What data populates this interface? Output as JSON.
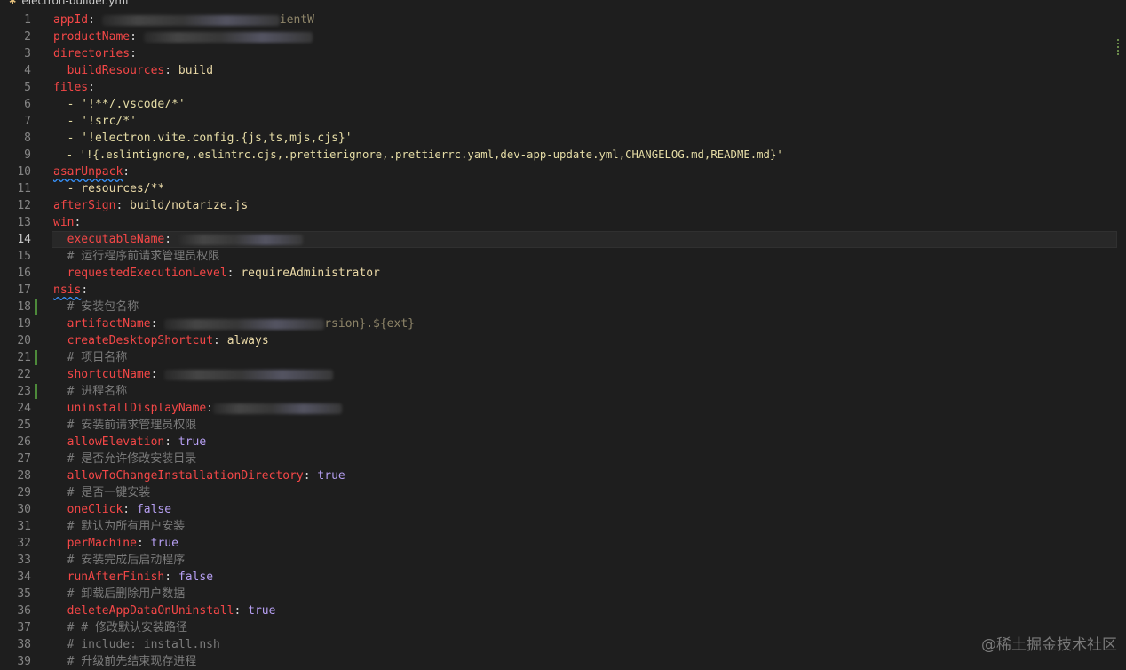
{
  "tab": {
    "filename": "electron-builder.yml",
    "icon": "yaml-file-icon"
  },
  "editor": {
    "lines": {
      "l1": {
        "num": "1",
        "key": "appId",
        "sep": ": "
      },
      "l2": {
        "num": "2",
        "key": "productName",
        "sep": ": "
      },
      "l3": {
        "num": "3",
        "key": "directories",
        "sep": ":"
      },
      "l4": {
        "num": "4",
        "indent": "  ",
        "key": "buildResources",
        "sep": ": ",
        "val": "build"
      },
      "l5": {
        "num": "5",
        "key": "files",
        "sep": ":"
      },
      "l6": {
        "num": "6",
        "val": "  - '!**/.vscode/*'"
      },
      "l7": {
        "num": "7",
        "val": "  - '!src/*'"
      },
      "l8": {
        "num": "8",
        "val": "  - '!electron.vite.config.{js,ts,mjs,cjs}'"
      },
      "l9": {
        "num": "9",
        "val": "  - '!{.eslintignore,.eslintrc.cjs,.prettierignore,.prettierrc.yaml,dev-app-update.yml,CHANGELOG.md,README.md}'"
      },
      "l10": {
        "num": "10",
        "key": "asarUnpack",
        "sep": ":"
      },
      "l11": {
        "num": "11",
        "val": "  - resources/**"
      },
      "l12": {
        "num": "12",
        "key": "afterSign",
        "sep": ": ",
        "val": "build/notarize.js"
      },
      "l13": {
        "num": "13",
        "key": "win",
        "sep": ":"
      },
      "l14": {
        "num": "14",
        "indent": "  ",
        "key": "executableName",
        "sep": ": "
      },
      "l15": {
        "num": "15",
        "comment": "  # 运行程序前请求管理员权限"
      },
      "l16": {
        "num": "16",
        "indent": "  ",
        "key": "requestedExecutionLevel",
        "sep": ": ",
        "val": "requireAdministrator"
      },
      "l17": {
        "num": "17",
        "key": "nsis",
        "sep": ":"
      },
      "l18": {
        "num": "18",
        "comment": "  # 安装包名称"
      },
      "l19": {
        "num": "19",
        "indent": "  ",
        "key": "artifactName",
        "sep": ": "
      },
      "l20": {
        "num": "20",
        "indent": "  ",
        "key": "createDesktopShortcut",
        "sep": ": ",
        "val": "always"
      },
      "l21": {
        "num": "21",
        "comment": "  # 项目名称"
      },
      "l22": {
        "num": "22",
        "indent": "  ",
        "key": "shortcutName",
        "sep": ": "
      },
      "l23": {
        "num": "23",
        "comment": "  # 进程名称"
      },
      "l24": {
        "num": "24",
        "indent": "  ",
        "key": "uninstallDisplayName",
        "sep": ":"
      },
      "l25": {
        "num": "25",
        "comment": "  # 安装前请求管理员权限"
      },
      "l26": {
        "num": "26",
        "indent": "  ",
        "key": "allowElevation",
        "sep": ": ",
        "bool": "true"
      },
      "l27": {
        "num": "27",
        "comment": "  # 是否允许修改安装目录"
      },
      "l28": {
        "num": "28",
        "indent": "  ",
        "key": "allowToChangeInstallationDirectory",
        "sep": ": ",
        "bool": "true"
      },
      "l29": {
        "num": "29",
        "comment": "  # 是否一键安装"
      },
      "l30": {
        "num": "30",
        "indent": "  ",
        "key": "oneClick",
        "sep": ": ",
        "bool": "false"
      },
      "l31": {
        "num": "31",
        "comment": "  # 默认为所有用户安装"
      },
      "l32": {
        "num": "32",
        "indent": "  ",
        "key": "perMachine",
        "sep": ": ",
        "bool": "true"
      },
      "l33": {
        "num": "33",
        "comment": "  # 安装完成后启动程序"
      },
      "l34": {
        "num": "34",
        "indent": "  ",
        "key": "runAfterFinish",
        "sep": ": ",
        "bool": "false"
      },
      "l35": {
        "num": "35",
        "comment": "  # 卸载后删除用户数据"
      },
      "l36": {
        "num": "36",
        "indent": "  ",
        "key": "deleteAppDataOnUninstall",
        "sep": ": ",
        "bool": "true"
      },
      "l37": {
        "num": "37",
        "comment": "  # # 修改默认安装路径"
      },
      "l38": {
        "num": "38",
        "comment": "  # include: install.nsh"
      },
      "l39": {
        "num": "39",
        "comment": "  # 升级前先结束现存进程"
      }
    },
    "partial": {
      "l1_tail": "ientW",
      "l19_tail": "rsion}.${ext}"
    }
  },
  "watermark": "@稀土掘金技术社区",
  "colors": {
    "background": "#1e1e1e",
    "key": "#f44747",
    "boolean": "#b69ff2",
    "comment": "#7b7b7b",
    "gutter": "#858585"
  }
}
